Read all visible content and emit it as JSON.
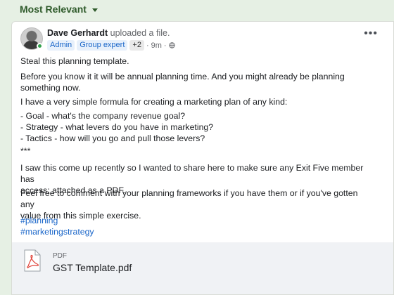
{
  "sort": {
    "label": "Most Relevant"
  },
  "post": {
    "author": "Dave Gerhardt",
    "action": "uploaded a file.",
    "badges": [
      "Admin",
      "Group expert",
      "+2"
    ],
    "time": "9m",
    "paragraphs": [
      "Steal this planning template.",
      "Before you know it it will be annual planning time. And you might already be planning\nsomething now.",
      "I have a very simple formula for creating a marketing plan of any kind:",
      "- Goal - what's the company revenue goal?\n- Strategy - what levers do you have in marketing?\n- Tactics - how will you go and pull those levers?",
      "***",
      "I saw this come up recently so I wanted to share here to make sure any Exit Five member has\naccess; attached as a PDF.",
      "Feel free to comment with your planning frameworks if you have them or if you've gotten any\nvalue from this simple exercise."
    ],
    "hashtags": [
      "#planning",
      "#marketingstrategy"
    ],
    "attachment": {
      "type": "PDF",
      "name": "GST Template.pdf"
    }
  },
  "colors": {
    "page_bg": "#e6f0e4",
    "accent": "#1a66c9",
    "sort_text": "#2e5a2a",
    "online": "#31a24c",
    "pdf_red": "#e0443a"
  }
}
